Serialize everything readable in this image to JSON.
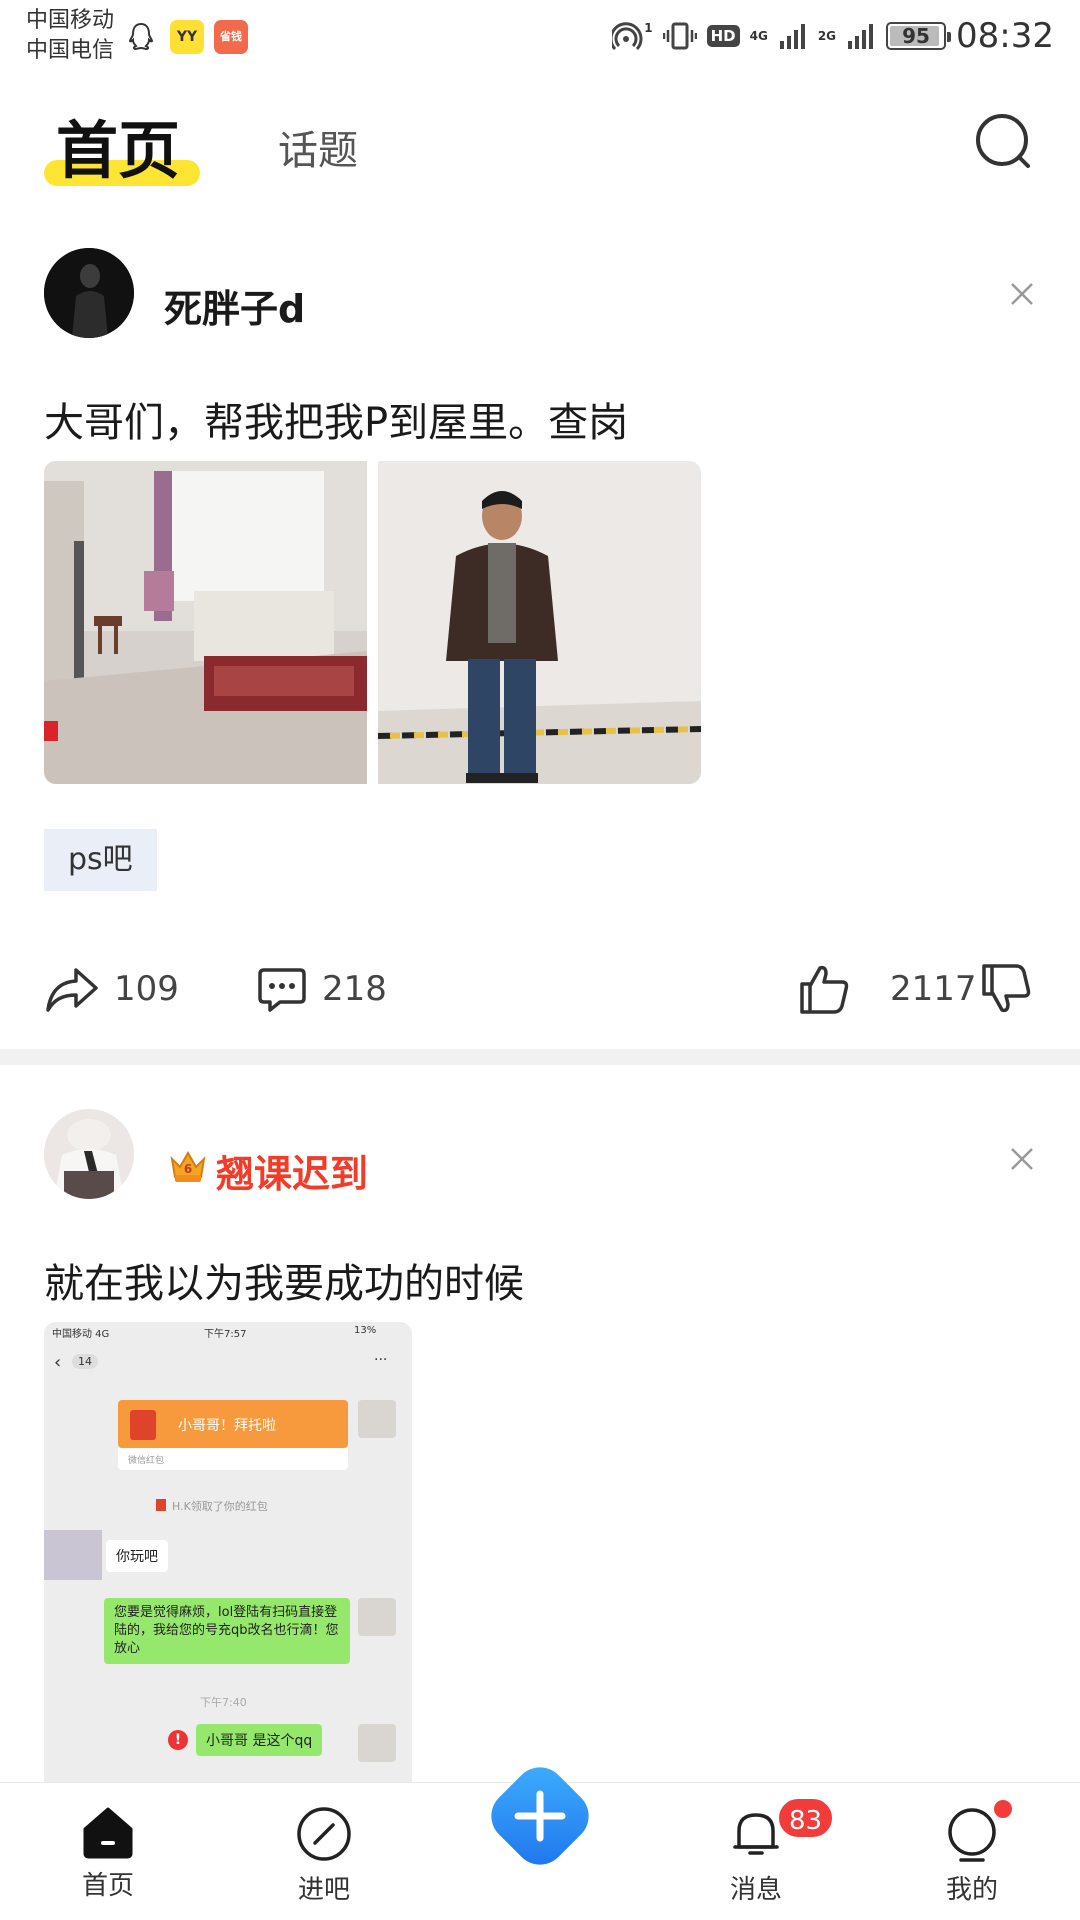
{
  "status_bar": {
    "carrier_1": "中国移动",
    "carrier_2": "中国电信",
    "app_icons": [
      "qq-icon",
      "yy-icon",
      "save-money-icon"
    ],
    "yy_label": "YY",
    "save_label": "省钱",
    "hd_label": "HD",
    "net1": "4G",
    "net2": "2G",
    "wifi_index": "1",
    "battery": "95",
    "battery_level": 0.95,
    "time": "08:32"
  },
  "header": {
    "tab_home": "首页",
    "tab_topic": "话题",
    "accent_color": "#ffe533"
  },
  "posts": [
    {
      "username": "死胖子d",
      "text": "大哥们，帮我把我P到屋里。查岗",
      "tag": "ps吧",
      "share_count": "109",
      "comment_count": "218",
      "like_count": "2117"
    },
    {
      "username": "翘课迟到",
      "username_color": "#f03c28",
      "text": "就在我以为我要成功的时候",
      "screenshot": {
        "status_left": "中国移动  4G",
        "status_time": "下午7:57",
        "status_right": "13%",
        "back_count": "14",
        "more": "···",
        "redpacket_text": "小哥哥！拜托啦",
        "redpacket_sub": "微信红包",
        "notice": "H.K领取了你的红包",
        "msg_left": "你玩吧",
        "msg_right": "您要是觉得麻烦，lol登陆有扫码直接登陆的，我给您的号充qb改名也行滴！您放心",
        "time_2": "下午7:40",
        "msg_last": "小哥哥 是这个qq"
      }
    }
  ],
  "bottom_nav": {
    "home": "首页",
    "enter_bar": "进吧",
    "messages": "消息",
    "mine": "我的",
    "message_badge": "83",
    "fab_color": "#2f8cf5"
  }
}
